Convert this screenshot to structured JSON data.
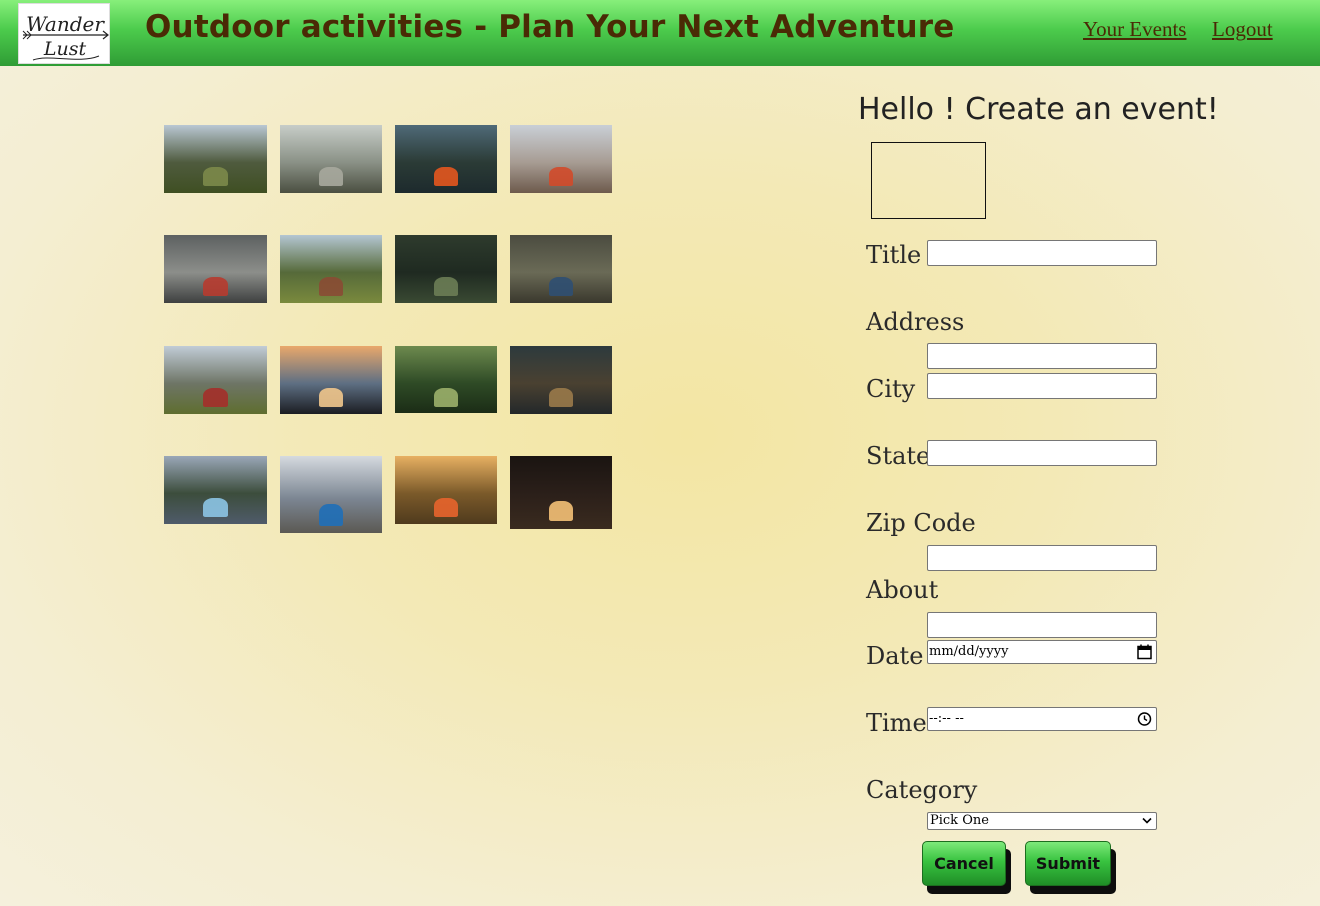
{
  "header": {
    "logo_text": "Wander Lust",
    "title": "Outdoor activities - Plan Your Next Adventure",
    "nav": {
      "your_events": "Your Events",
      "logout": "Logout"
    }
  },
  "gallery": {
    "photos": [
      {
        "subject": "granite cliff valley with pines",
        "sky": "#b9c7d3",
        "mid": "#4f5b3e",
        "ground": "#3f4f22",
        "accent": "#7c8a4a"
      },
      {
        "subject": "misty tall forest",
        "sky": "#c7cdc8",
        "mid": "#8a9186",
        "ground": "#4b4f41",
        "accent": "#a7a99d"
      },
      {
        "subject": "red kayak bow on mountain lake",
        "sky": "#4f6a78",
        "mid": "#2b3b36",
        "ground": "#1d2a2d",
        "accent": "#e4561e"
      },
      {
        "subject": "snowy mountains with tent",
        "sky": "#c9cfd6",
        "mid": "#a79c93",
        "ground": "#6d5a4c",
        "accent": "#d24a2a"
      },
      {
        "subject": "backpacks on rocks",
        "sky": "#5d6161",
        "mid": "#8c8e8a",
        "ground": "#3e4040",
        "accent": "#b73b2f"
      },
      {
        "subject": "hikers in green meadow",
        "sky": "#b4c6d2",
        "mid": "#566a3a",
        "ground": "#7a8a3d",
        "accent": "#8a4b34"
      },
      {
        "subject": "dense dark forest",
        "sky": "#2e3b2d",
        "mid": "#1f2a21",
        "ground": "#3a4a33",
        "accent": "#6b7d55"
      },
      {
        "subject": "feet on forest log",
        "sky": "#4b4c40",
        "mid": "#6a6a56",
        "ground": "#3a382d",
        "accent": "#2f4f72"
      },
      {
        "subject": "hiker on mountain trail",
        "sky": "#c1ccd6",
        "mid": "#6e7566",
        "ground": "#5f6e2f",
        "accent": "#a42f2a"
      },
      {
        "subject": "sunset from tent door",
        "sky": "#e9a86b",
        "mid": "#5e6f83",
        "ground": "#1b1d22",
        "accent": "#f1c68c"
      },
      {
        "subject": "lush jungle valley",
        "sky": "#6d8a4e",
        "mid": "#2f4b26",
        "ground": "#1b2c16",
        "accent": "#9bb06a"
      },
      {
        "subject": "forest path at dusk",
        "sky": "#2d3a3d",
        "mid": "#4a4131",
        "ground": "#23282a",
        "accent": "#9a7a4a"
      },
      {
        "subject": "kayak on lake with hills",
        "sky": "#9aa7b8",
        "mid": "#3c4d3c",
        "ground": "#4f5b6a",
        "accent": "#8cc4e4"
      },
      {
        "subject": "blue kayak on shore",
        "sky": "#d5dadf",
        "mid": "#7c8693",
        "ground": "#5b5953",
        "accent": "#1f6fb8"
      },
      {
        "subject": "orange tent in sunlit forest",
        "sky": "#e7b062",
        "mid": "#7b5a2a",
        "ground": "#4f3a1d",
        "accent": "#e8642c"
      },
      {
        "subject": "campfire at night",
        "sky": "#1a1411",
        "mid": "#2c201a",
        "ground": "#3a2b1f",
        "accent": "#f4c177"
      }
    ]
  },
  "form": {
    "heading": "Hello ! Create an event!",
    "labels": {
      "title": "Title",
      "address": "Address",
      "city": "City",
      "state": "State",
      "zip": "Zip Code",
      "about": "About",
      "date": "Date",
      "time": "Time",
      "category": "Category"
    },
    "values": {
      "title": "",
      "address": "",
      "city": "",
      "state": "",
      "zip": "",
      "about": ""
    },
    "date_placeholder": "mm/dd/yyyy",
    "time_placeholder": "--:-- --",
    "category_selected": "Pick One",
    "buttons": {
      "cancel": "Cancel",
      "submit": "Submit"
    }
  },
  "colors": {
    "header_green": "#4ccb4c",
    "header_text": "#4a2a05",
    "button_green": "#38c23f",
    "background": "#f3e9b6"
  }
}
